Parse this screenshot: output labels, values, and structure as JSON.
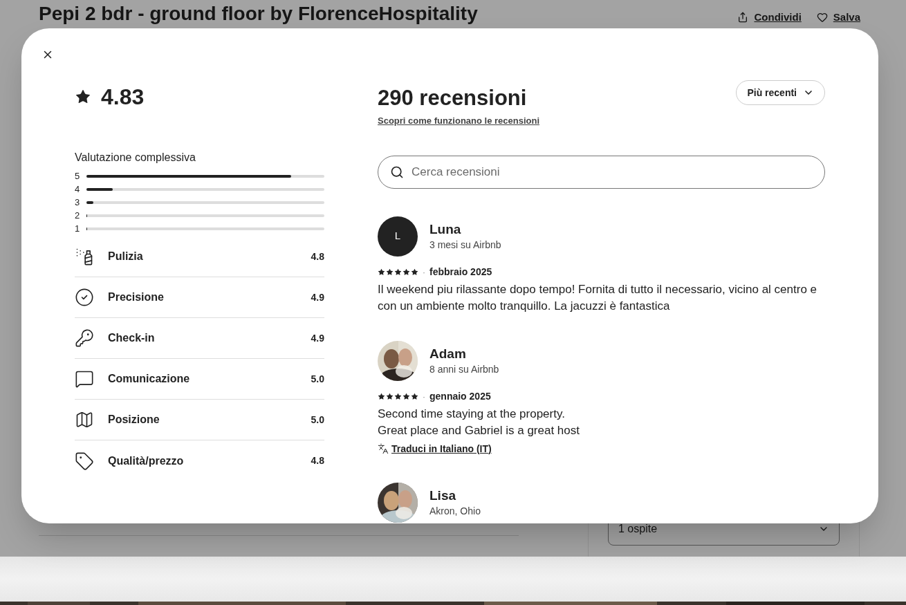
{
  "backdrop": {
    "title": "Pepi 2 bdr - ground floor by FlorenceHospitality",
    "actions": [
      {
        "kind": "share",
        "label": "Condividi"
      },
      {
        "kind": "save",
        "label": "Salva"
      }
    ],
    "guests_field": {
      "value": "1 ospite"
    }
  },
  "modal": {
    "rating": "4.83",
    "overall": {
      "title": "Valutazione complessiva",
      "bars": [
        {
          "label": "5",
          "level": 0.86
        },
        {
          "label": "4",
          "level": 0.11
        },
        {
          "label": "3",
          "level": 0.03
        },
        {
          "label": "2",
          "level": 0
        },
        {
          "label": "1",
          "level": 0
        }
      ]
    },
    "categories": [
      {
        "kind": "cleanliness",
        "label": "Pulizia",
        "score": "4.8"
      },
      {
        "kind": "accuracy",
        "label": "Precisione",
        "score": "4.9"
      },
      {
        "kind": "checkin",
        "label": "Check-in",
        "score": "4.9"
      },
      {
        "kind": "communication",
        "label": "Comunicazione",
        "score": "5.0"
      },
      {
        "kind": "location",
        "label": "Posizione",
        "score": "5.0"
      },
      {
        "kind": "value",
        "label": "Qualità/prezzo",
        "score": "4.8"
      }
    ],
    "reviews_title": "290 recensioni",
    "reviews_link": "Scopri come funzionano le recensioni",
    "sort": "Più recenti",
    "search": {
      "placeholder": "Cerca recensioni"
    },
    "reviews": [
      {
        "name": "Luna",
        "avatar": {
          "kind": "initial",
          "initial": "L"
        },
        "meta": "3 mesi su Airbnb",
        "stars": 5,
        "separator": "·",
        "date": "febbraio 2025",
        "text": "Il weekend piu rilassante dopo tempo! Fornita di tutto il necessario, vicino al centro e con un ambiente molto tranquillo. La jacuzzi è fantastica"
      },
      {
        "name": "Adam",
        "meta": "8 anni su Airbnb",
        "stars": 5,
        "separator": "·",
        "date": "gennaio 2025",
        "text": "Second time staying at the property.\nGreat place and Gabriel is a great host",
        "translate": "Traduci in Italiano (IT)"
      },
      {
        "name": "Lisa",
        "meta": "Akron, Ohio"
      }
    ]
  }
}
